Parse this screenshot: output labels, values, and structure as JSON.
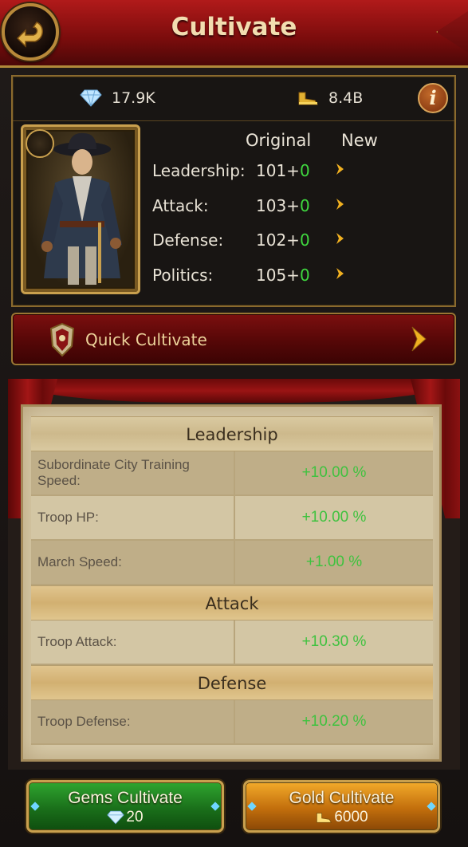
{
  "header": {
    "title": "Cultivate"
  },
  "resources": {
    "gems": "17.9K",
    "gold": "8.4B"
  },
  "stats": {
    "col_original": "Original",
    "col_new": "New",
    "rows": [
      {
        "label": "Leadership:",
        "base": "101+",
        "bonus": "0"
      },
      {
        "label": "Attack:",
        "base": "103+",
        "bonus": "0"
      },
      {
        "label": "Defense:",
        "base": "102+",
        "bonus": "0"
      },
      {
        "label": "Politics:",
        "base": "105+",
        "bonus": "0"
      }
    ]
  },
  "quick": {
    "label": "Quick Cultivate"
  },
  "bonuses": {
    "leadership": {
      "title": "Leadership",
      "rows": [
        {
          "name": "Subordinate City Training Speed:",
          "value": "+10.00 %"
        },
        {
          "name": "Troop HP:",
          "value": "+10.00 %"
        },
        {
          "name": "March Speed:",
          "value": "+1.00 %"
        }
      ]
    },
    "attack": {
      "title": "Attack",
      "rows": [
        {
          "name": "Troop Attack:",
          "value": "+10.30 %"
        }
      ]
    },
    "defense": {
      "title": "Defense",
      "rows": [
        {
          "name": "Troop Defense:",
          "value": "+10.20 %"
        }
      ]
    }
  },
  "buttons": {
    "gems": {
      "label": "Gems Cultivate",
      "cost": "20"
    },
    "gold": {
      "label": "Gold Cultivate",
      "cost": "6000"
    }
  },
  "icons": {
    "back": "back-arrow-icon",
    "gem": "diamond-icon",
    "gold": "gold-boot-icon",
    "info": "info-icon",
    "quick": "armor-icon",
    "arrow": "chevron-right-icon"
  },
  "colors": {
    "accent_red": "#8e1313",
    "gold_border": "#c9a04e",
    "bonus_green": "#3fd83f"
  }
}
